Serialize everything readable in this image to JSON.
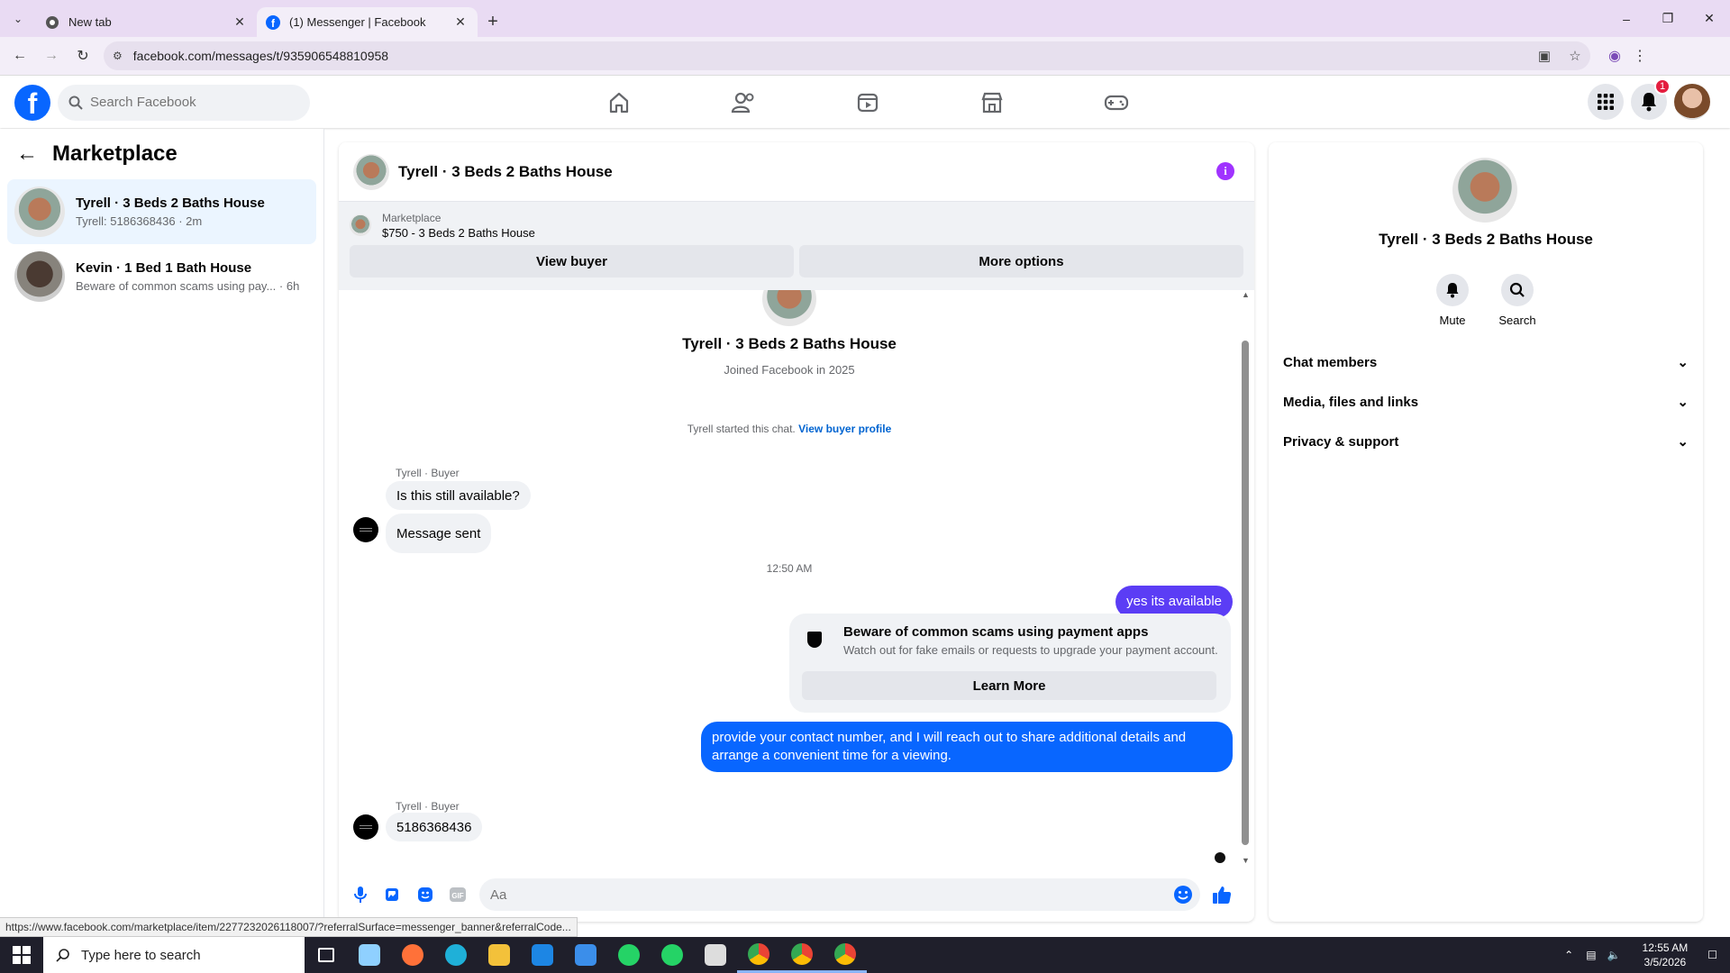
{
  "browser": {
    "tabs": [
      {
        "label": "New tab",
        "active": false
      },
      {
        "label": "(1) Messenger | Facebook",
        "active": true
      }
    ],
    "url": "facebook.com/messages/t/935906548810958",
    "status_url": "https://www.facebook.com/marketplace/item/2277232026118007/?referralSurface=messenger_banner&referralCode..."
  },
  "fb_header": {
    "search_placeholder": "Search Facebook",
    "notification_count": "1",
    "nav_icons": [
      "home-icon",
      "friends-icon",
      "watch-icon",
      "marketplace-icon",
      "gaming-icon"
    ]
  },
  "sidebar": {
    "title": "Marketplace",
    "conversations": [
      {
        "title": "Tyrell · 3 Beds 2 Baths House",
        "preview": "Tyrell: 5186368436 · 2m",
        "selected": true
      },
      {
        "title": "Kevin · 1 Bed 1 Bath House",
        "preview": "Beware of common scams using pay...",
        "time": "· 6h",
        "selected": false
      }
    ]
  },
  "chat": {
    "title": "Tyrell · 3 Beds 2 Baths House",
    "marketplace_label": "Marketplace",
    "listing": "$750 - 3 Beds 2 Baths House",
    "view_buyer": "View buyer",
    "more_options": "More options",
    "profile_name": "Tyrell · 3 Beds 2 Baths House",
    "joined": "Joined Facebook in 2025",
    "started_text": "Tyrell started this chat.",
    "view_buyer_profile": "View buyer profile",
    "sender_label": "Tyrell · Buyer",
    "msg1": "Is this still available?",
    "msg2": "Message sent",
    "timestamp": "12:50 AM",
    "out1": "yes its available",
    "scam_title": "Beware of common scams using payment apps",
    "scam_sub": "Watch out for fake emails or requests to upgrade your payment account.",
    "learn_more": "Learn More",
    "out2": "provide your contact number, and I will reach out to share additional details and arrange a convenient time for a viewing.",
    "sender_label2": "Tyrell · Buyer",
    "msg3": "5186368436",
    "composer_placeholder": "Aa"
  },
  "right_panel": {
    "name": "Tyrell · 3 Beds 2 Baths House",
    "mute": "Mute",
    "search": "Search",
    "sections": [
      "Chat members",
      "Media, files and links",
      "Privacy & support"
    ]
  },
  "taskbar": {
    "search_placeholder": "Type here to search",
    "time": "12:55 AM",
    "date": "3/5/2026"
  },
  "colors": {
    "fb_blue": "#0866ff",
    "outgoing_purple": "#5b3df5",
    "info_purple": "#a033ff"
  }
}
